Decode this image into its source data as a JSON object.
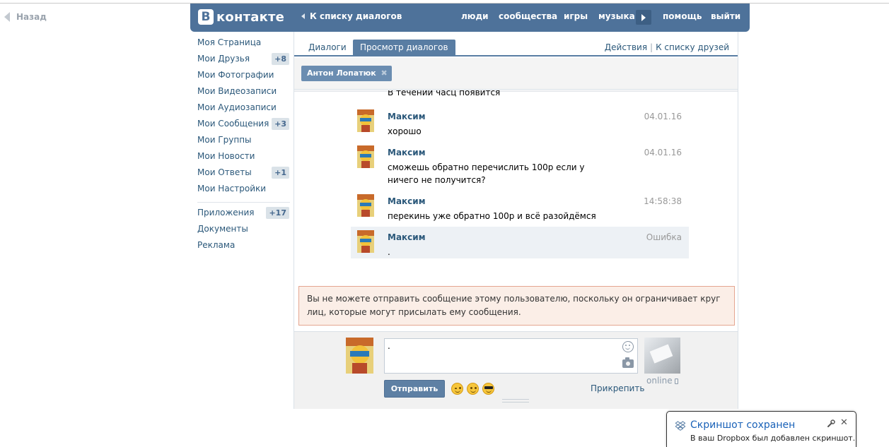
{
  "back_label": "Назад",
  "header": {
    "logo_letter": "В",
    "logo_text": "контакте",
    "back_link": "К списку диалогов",
    "nav": [
      "люди",
      "сообщества",
      "игры",
      "музыка",
      "помощь",
      "выйти"
    ]
  },
  "left_menu": {
    "items": [
      {
        "label": "Моя Страница",
        "count": ""
      },
      {
        "label": "Мои Друзья",
        "count": "+8"
      },
      {
        "label": "Мои Фотографии",
        "count": ""
      },
      {
        "label": "Мои Видеозаписи",
        "count": ""
      },
      {
        "label": "Мои Аудиозаписи",
        "count": ""
      },
      {
        "label": "Мои Сообщения",
        "count": "+3"
      },
      {
        "label": "Мои Группы",
        "count": ""
      },
      {
        "label": "Мои Новости",
        "count": ""
      },
      {
        "label": "Мои Ответы",
        "count": "+1"
      },
      {
        "label": "Мои Настройки",
        "count": ""
      }
    ],
    "extra": [
      {
        "label": "Приложения",
        "count": "+17"
      },
      {
        "label": "Документы",
        "count": ""
      },
      {
        "label": "Реклама",
        "count": ""
      }
    ]
  },
  "tabs": {
    "dialogs": "Диалоги",
    "view_dialogs": "Просмотр диалогов",
    "actions": "Действия",
    "separator": "|",
    "to_friends": "К списку друзей"
  },
  "peer_chip": "Антон Лопатюк",
  "chip_close": "✖",
  "prev_message_text": "В течении часц появится",
  "messages": [
    {
      "author": "Максим",
      "date": "04.01.16",
      "text": "хорошо",
      "error": false
    },
    {
      "author": "Максим",
      "date": "04.01.16",
      "text": "сможешь обратно перечислить 100р если у ничего не получится?",
      "error": false
    },
    {
      "author": "Максим",
      "date": "14:58:38",
      "text": "перекинь уже обратно 100р и всё разойдёмся",
      "error": false
    },
    {
      "author": "Максим",
      "date": "Ошибка",
      "text": ".",
      "error": true
    }
  ],
  "warning": "Вы не можете отправить сообщение этому пользователю, поскольку он ограничивает круг лиц, которые могут присылать ему сообщения.",
  "composer": {
    "value": ".",
    "send_label": "Отправить",
    "attach_label": "Прикрепить",
    "online_label": "online"
  },
  "toast": {
    "title": "Скриншот сохранен",
    "text": "В ваш Dropbox был добавлен скриншот.",
    "close": "✕"
  },
  "colors": {
    "header_bg": "#4e729a",
    "link": "#2b587a",
    "active_tab": "#597da3",
    "warning_bg": "#fbeee7",
    "warning_border": "#e5a691",
    "error_row_bg": "#edf1f5"
  }
}
